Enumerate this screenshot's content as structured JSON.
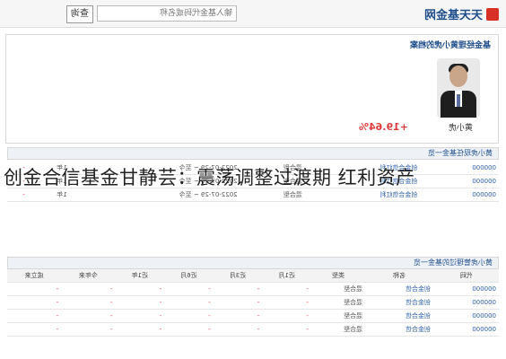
{
  "caption": "创金合信基金甘静芸：震荡调整过渡期 红利资产",
  "topbar": {
    "brand": "天天基金网",
    "search_placeholder": "输入基金代码或名称",
    "search_button": "查询"
  },
  "profile": {
    "tab": "基金经理黄小虎的档案",
    "manager_name": "黄小虎",
    "return": "+19.64%"
  },
  "sections": {
    "current_funds": "黄小虎现任基金一览",
    "history_funds": "黄小虎管理过的基金一览"
  }
}
